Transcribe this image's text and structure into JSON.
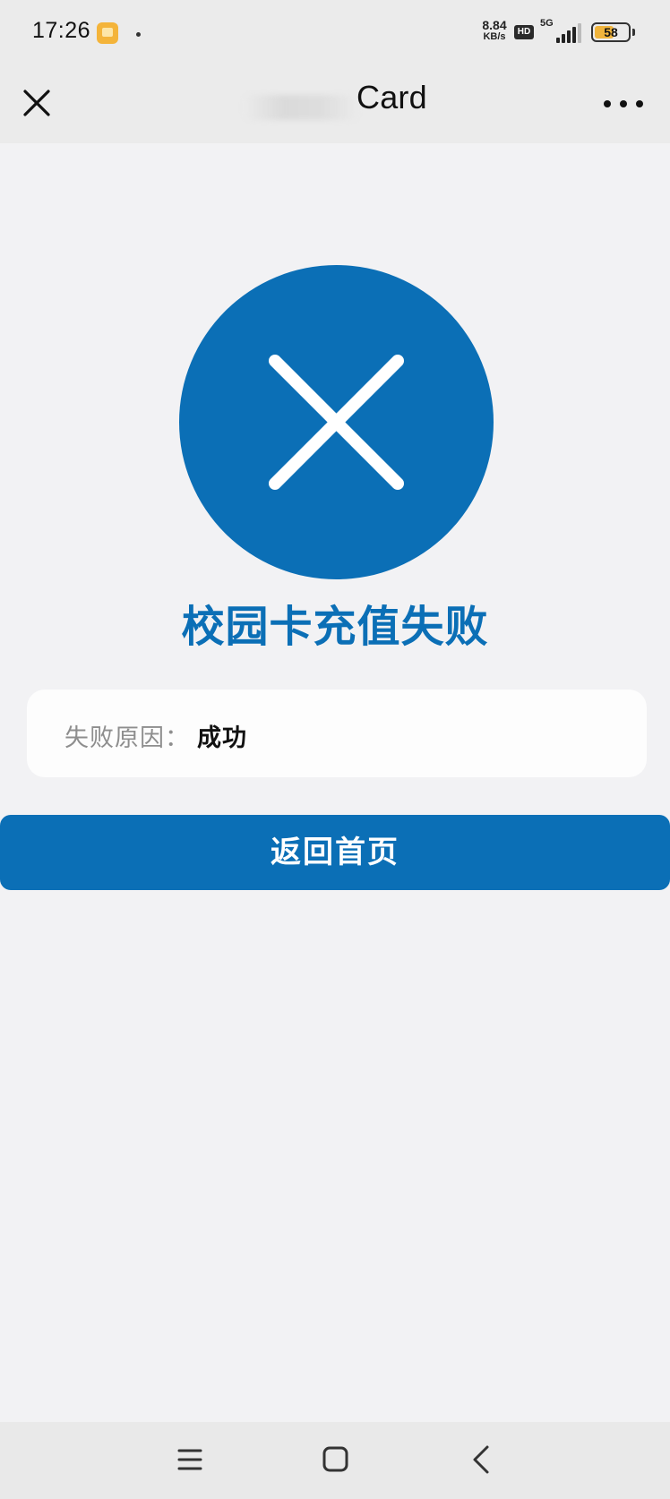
{
  "status_bar": {
    "time": "17:26",
    "net_speed_value": "8.84",
    "net_speed_unit": "KB/s",
    "hd_label": "HD",
    "network_type": "5G",
    "battery_level": "58",
    "icons": [
      "gallery-notification-icon",
      "hd-icon",
      "signal-icon",
      "battery-icon"
    ]
  },
  "nav_bar": {
    "title": "Card",
    "icons": [
      "close-icon",
      "more-icon"
    ]
  },
  "result": {
    "icon": "failure-x-icon",
    "title": "校园卡充值失败",
    "reason_label": "失败原因：",
    "reason_value": "成功"
  },
  "actions": {
    "home_button_label": "返回首页"
  },
  "system_nav": {
    "icons": [
      "menu-icon",
      "home-icon",
      "back-icon"
    ]
  },
  "colors": {
    "accent": "#0b6fb6",
    "background": "#f2f2f4",
    "card": "#fdfdfd",
    "label_gray": "#8e8e8e"
  }
}
